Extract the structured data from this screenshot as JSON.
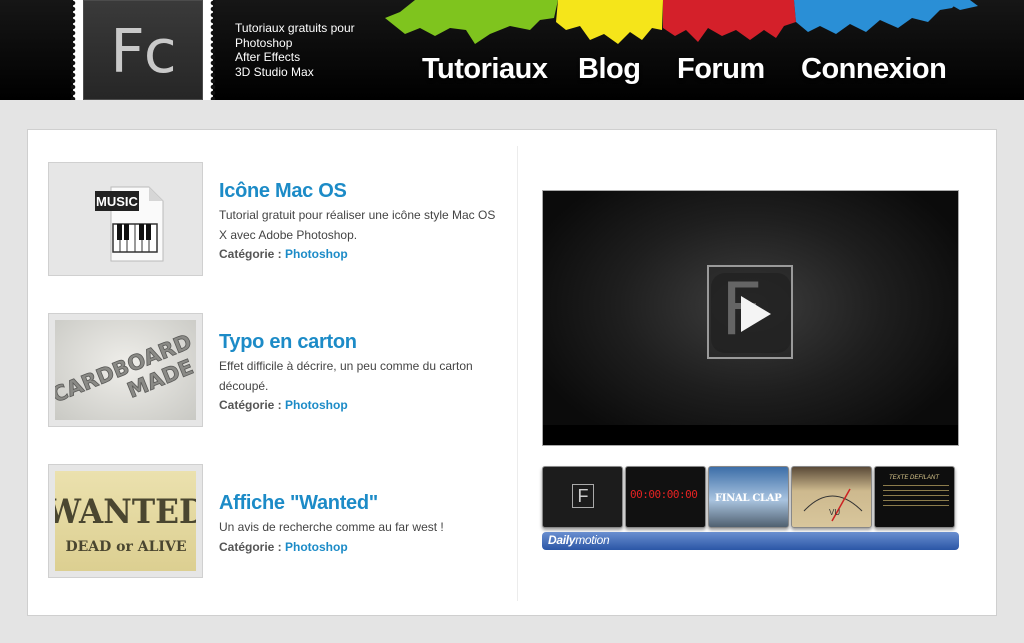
{
  "header": {
    "logo_text": "Fc",
    "tagline": [
      "Tutoriaux gratuits pour",
      "Photoshop",
      "After Effects",
      "3D Studio Max"
    ],
    "nav": [
      {
        "label": "Tutoriaux"
      },
      {
        "label": "Blog"
      },
      {
        "label": "Forum"
      },
      {
        "label": "Connexion"
      }
    ],
    "splash_colors": [
      "#7fc41e",
      "#f5e51a",
      "#d4202a",
      "#2a8fd6"
    ]
  },
  "articles": [
    {
      "title": "Icône Mac OS",
      "desc": "Tutorial gratuit pour réaliser une icône style Mac OS X avec Adobe Photoshop.",
      "cat_label": "Catégorie : ",
      "cat_value": "Photoshop",
      "thumb_text": "MUSIC"
    },
    {
      "title": "Typo en carton",
      "desc": "Effet difficile à décrire, un peu comme du carton découpé.",
      "cat_label": "Catégorie : ",
      "cat_value": "Photoshop",
      "thumb_text": [
        "CARDBOARD",
        "MADE"
      ]
    },
    {
      "title": "Affiche \"Wanted\"",
      "desc": "Un avis de recherche comme au far west !",
      "cat_label": "Catégorie : ",
      "cat_value": "Photoshop",
      "thumb_text": [
        "WANTED",
        "DEAD or ALIVE"
      ]
    }
  ],
  "video": {
    "logo_letter": "F",
    "strip": [
      {
        "label": "F"
      },
      {
        "label": "00:00:00:00"
      },
      {
        "label": "FINAL CLAP"
      },
      {
        "label": "VU"
      },
      {
        "label": "TEXTE DEFILANT"
      }
    ],
    "brand": {
      "part1": "Daily",
      "part2": "motion"
    }
  },
  "colors": {
    "accent": "#1c8bc7",
    "background": "#e4e4e4"
  }
}
